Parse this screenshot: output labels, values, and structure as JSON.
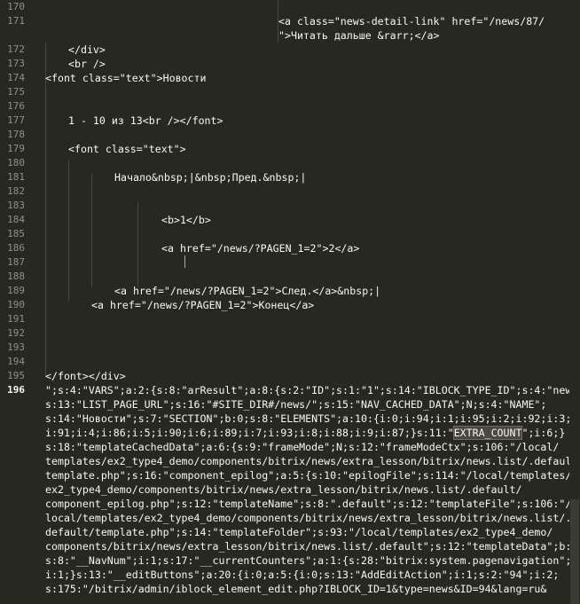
{
  "editor": {
    "line_numbers": [
      "170",
      "171",
      "",
      "172",
      "173",
      "174",
      "175",
      "176",
      "177",
      "178",
      "179",
      "180",
      "181",
      "182",
      "183",
      "184",
      "185",
      "186",
      "187",
      "188",
      "189",
      "190",
      "191",
      "192",
      "193",
      "194",
      "195",
      "196"
    ],
    "active_line": "196",
    "lines": [
      {
        "text": ""
      },
      {
        "text": "<a class=\"news-detail-link\" href=\"/news/87/"
      },
      {
        "text": "\">Читать дальше &rarr;</a>"
      },
      {
        "text": "</div>"
      },
      {
        "text": "<br />"
      },
      {
        "text": "<font class=\"text\">Новости"
      },
      {
        "text": ""
      },
      {
        "text": ""
      },
      {
        "text": "1 - 10 из 13<br /></font>"
      },
      {
        "text": ""
      },
      {
        "text": "<font class=\"text\">"
      },
      {
        "text": ""
      },
      {
        "text": "Начало&nbsp;|&nbsp;Пред.&nbsp;|"
      },
      {
        "text": ""
      },
      {
        "text": ""
      },
      {
        "text": "<b>1</b>"
      },
      {
        "text": ""
      },
      {
        "text": "<a href=\"/news/?PAGEN_1=2\">2</a>"
      },
      {
        "text": ""
      },
      {
        "text": ""
      },
      {
        "text": "<a href=\"/news/?PAGEN_1=2\">След.</a>&nbsp;|"
      },
      {
        "text": "<a href=\"/news/?PAGEN_1=2\">Конец</a>"
      },
      {
        "text": ""
      },
      {
        "text": ""
      },
      {
        "text": ""
      },
      {
        "text": ""
      },
      {
        "text": "</font></div>"
      }
    ],
    "wrapped_196": [
      "\";s:4:\"VARS\";a:2:{s:8:\"arResult\";a:8:{s:2:\"ID\";s:1:\"1\";s:14:\"IBLOCK_TYPE_ID\";s:4:\"news\";",
      "s:13:\"LIST_PAGE_URL\";s:16:\"#SITE_DIR#/news/\";s:15:\"NAV_CACHED_DATA\";N;s:4:\"NAME\";",
      "s:14:\"Новости\";s:7:\"SECTION\";b:0;s:8:\"ELEMENTS\";a:10:{i:0;i:94;i:1;i:95;i:2;i:92;i:3;",
      "i:91;i:4;i:86;i:5;i:90;i:6;i:89;i:7;i:93;i:8;i:88;i:9;i:87;}s:11:\"",
      "EXTRA_COUNT",
      "\";i:6;}",
      "s:18:\"templateCachedData\";a:6:{s:9:\"frameMode\";N;s:12:\"frameModeCtx\";s:106:\"/local/",
      "templates/ex2_type4_demo/components/bitrix/news/extra_lesson/bitrix/news.list/.default/",
      "template.php\";s:16:\"component_epilog\";a:5:{s:10:\"epilogFile\";s:114:\"/local/templates/",
      "ex2_type4_demo/components/bitrix/news/extra_lesson/bitrix/news.list/.default/",
      "component_epilog.php\";s:12:\"templateName\";s:8:\".default\";s:12:\"templateFile\";s:106:\"/",
      "local/templates/ex2_type4_demo/components/bitrix/news/extra_lesson/bitrix/news.list/.",
      "default/template.php\";s:14:\"templateFolder\";s:93:\"/local/templates/ex2_type4_demo/",
      "components/bitrix/news/extra_lesson/bitrix/news.list/.default\";s:12:\"templateData\";b:0;}",
      "s:8:\"__NavNum\";i:1;s:17:\"__currentCounters\";a:1:{s:28:\"bitrix:system.pagenavigation\";",
      "i:1;}s:13:\"__editButtons\";a:20:{i:0;a:5:{i:0;s:13:\"AddEditAction\";i:1;s:2:\"94\";i:2;",
      "s:175:\"/bitrix/admin/iblock_element_edit.php?IBLOCK_ID=1&type=news&ID=94&lang=ru&"
    ],
    "highlight_word": "EXTRA_COUNT"
  }
}
